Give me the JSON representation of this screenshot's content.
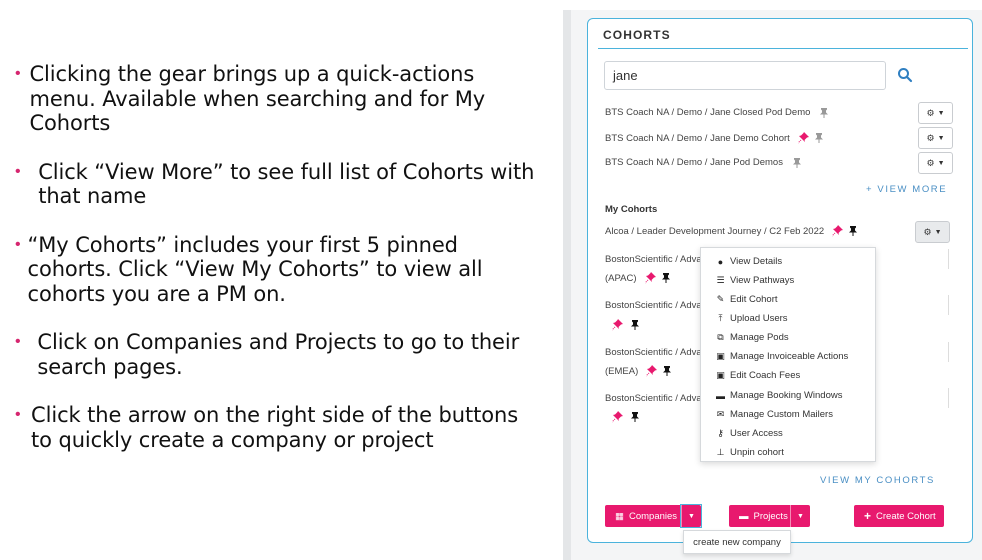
{
  "bullets": [
    "Clicking the gear brings up a quick-actions menu. Available when searching and for My Cohorts",
    "Click “View More” to see full list of Cohorts with that name",
    "“My Cohorts” includes your first 5 pinned cohorts. Click “View My Cohorts” to view all cohorts you are a PM on.",
    "Click on Companies and Projects to go to their search pages.",
    "Click the arrow on the right side of the buttons to quickly create a company or project"
  ],
  "panel": {
    "title": "COHORTS",
    "search_value": "jane",
    "results": [
      "BTS Coach NA / Demo / Jane Closed Pod Demo",
      "BTS Coach NA / Demo / Jane Demo Cohort",
      "BTS Coach NA / Demo / Jane Pod Demos"
    ],
    "view_more": "+ VIEW MORE",
    "my_cohorts_heading": "My Cohorts",
    "my_cohorts": {
      "first": "Alcoa / Leader Development Journey / C2 Feb 2022",
      "bsci1a": "BostonScientific / Adva",
      "bsci1b": "(APAC)",
      "bsci2": "BostonScientific / Adva",
      "bsci3a": "BostonScientific / Adva",
      "bsci3b": "(EMEA)",
      "bsci4": "BostonScientific / Adva"
    },
    "menu": [
      "View Details",
      "View Pathways",
      "Edit Cohort",
      "Upload Users",
      "Manage Pods",
      "Manage Invoiceable Actions",
      "Edit Coach Fees",
      "Manage Booking Windows",
      "Manage Custom Mailers",
      "User Access",
      "Unpin cohort"
    ],
    "view_my_cohorts": "VIEW MY COHORTS",
    "companies_label": "Companies",
    "projects_label": "Projects",
    "create_cohort_label": "Create Cohort",
    "tooltip": "create new company"
  },
  "colors": {
    "accent_pink": "#e8196e",
    "border_blue": "#4bb3dc",
    "link_blue": "#4a8fc4"
  }
}
